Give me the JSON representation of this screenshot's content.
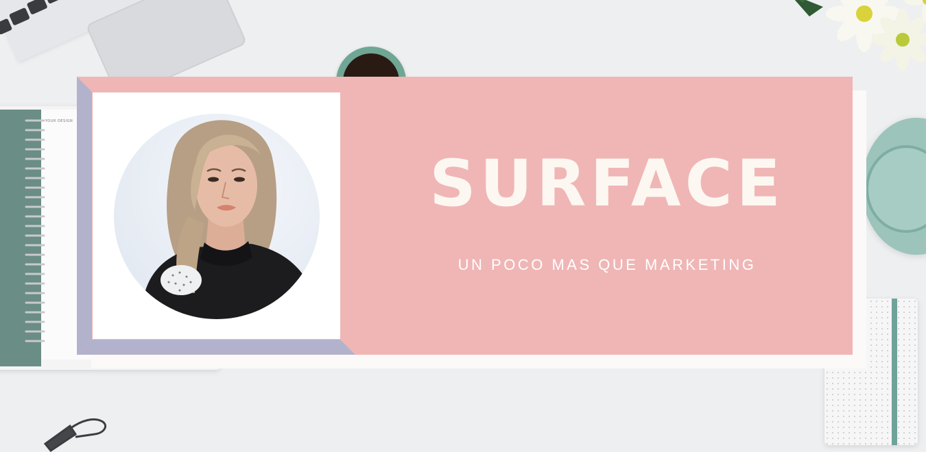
{
  "banner": {
    "title": "SURFACE",
    "subtitle": "UN POCO MAS QUE MARKETING"
  },
  "notebook": {
    "label": "YOUR DESIGN"
  },
  "colors": {
    "banner_pink": "#efb6b5",
    "accent_lavender": "#b3b2cc",
    "title_text": "#fdf7f1",
    "background": "#eeeff1"
  }
}
